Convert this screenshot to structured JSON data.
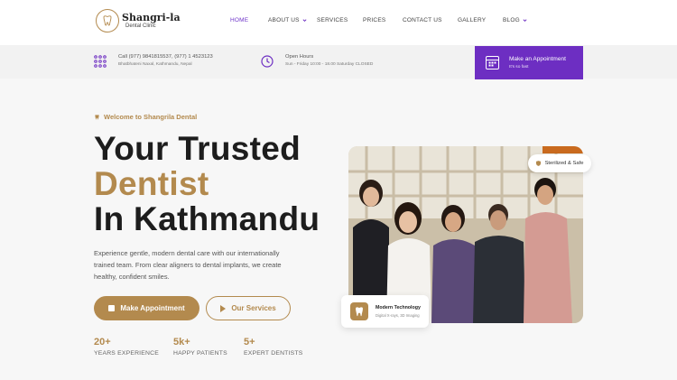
{
  "brand": {
    "name": "Shangri-la",
    "subtitle": "Dental Clinic"
  },
  "nav": {
    "items": [
      {
        "label": "HOME",
        "active": true
      },
      {
        "label": "ABOUT US",
        "dropdown": true
      },
      {
        "label": "SERVICES"
      },
      {
        "label": "PRICES"
      },
      {
        "label": "CONTACT US"
      },
      {
        "label": "GALLERY"
      },
      {
        "label": "BLOG",
        "dropdown": true
      }
    ]
  },
  "info": {
    "contact": {
      "line1": "Call (977) 9841815537, (977) 1 4523123",
      "line2": "Bhatbhateni Naxal, Kathmandu, Nepal",
      "icon": "dots-grid-icon"
    },
    "hours": {
      "line1": "Open Hours",
      "line2": "Sun - Friday 10:00 - 18.00 Saturday CLOSED",
      "icon": "clock-icon"
    },
    "appointment": {
      "line1": "Make an Appointment",
      "line2": "It's so fast",
      "icon": "calendar-icon"
    }
  },
  "hero": {
    "eyebrow": "Welcome to Shangrila Dental",
    "title_line1": "Your Trusted",
    "title_line2": "Dentist",
    "title_line3": "In Kathmandu",
    "description": "Experience gentle, modern dental care with our internationally trained team. From clear aligners to dental implants, we create healthy, confident smiles.",
    "primary_button": "Make Appointment",
    "secondary_button": "Our Services",
    "stats": [
      {
        "value": "20+",
        "label": "YEARS EXPERIENCE"
      },
      {
        "value": "5k+",
        "label": "HAPPY PATIENTS"
      },
      {
        "value": "5+",
        "label": "EXPERT DENTISTS"
      }
    ]
  },
  "photo_card": {
    "badge": "Sterilized & Safe",
    "feature_title": "Modern Technology",
    "feature_sub": "Digital X-rays, 3D Imaging"
  },
  "colors": {
    "accent_gold": "#b38a4e",
    "accent_purple": "#6d2ec2",
    "nav_active": "#6f35c9"
  }
}
